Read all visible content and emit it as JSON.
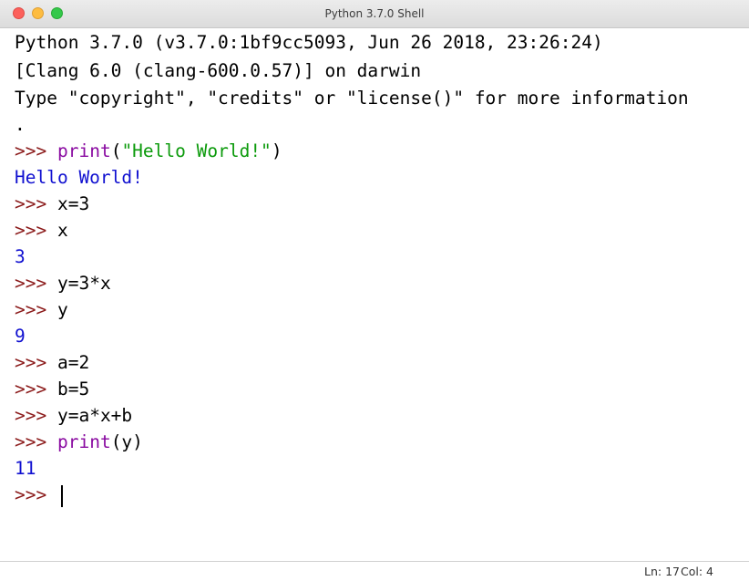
{
  "window": {
    "title": "Python 3.7.0 Shell"
  },
  "shell": {
    "banner": [
      "Python 3.7.0 (v3.7.0:1bf9cc5093, Jun 26 2018, 23:26:24)",
      "[Clang 6.0 (clang-600.0.57)] on darwin",
      "Type \"copyright\", \"credits\" or \"license()\" for more information",
      "."
    ],
    "prompt": ">>>",
    "lines": {
      "l5_kw": "print",
      "l5_open": "(",
      "l5_str": "\"Hello World!\"",
      "l5_close": ")",
      "l6_out": "Hello World!",
      "l7_code": "x=3",
      "l8_code": "x",
      "l9_out": "3",
      "l10_code": "y=3*x",
      "l11_code": "y",
      "l12_out": "9",
      "l13_code": "a=2",
      "l14_code": "b=5",
      "l15_code": "y=a*x+b",
      "l16_kw": "print",
      "l16_rest": "(y)",
      "l17_out": "11"
    }
  },
  "status": {
    "ln": "Ln: 17",
    "col": "Col: 4"
  },
  "colors": {
    "prompt": "#8b1a1a",
    "keyword": "#8a0ba1",
    "string": "#0b9a0b",
    "output": "#1010d0"
  }
}
